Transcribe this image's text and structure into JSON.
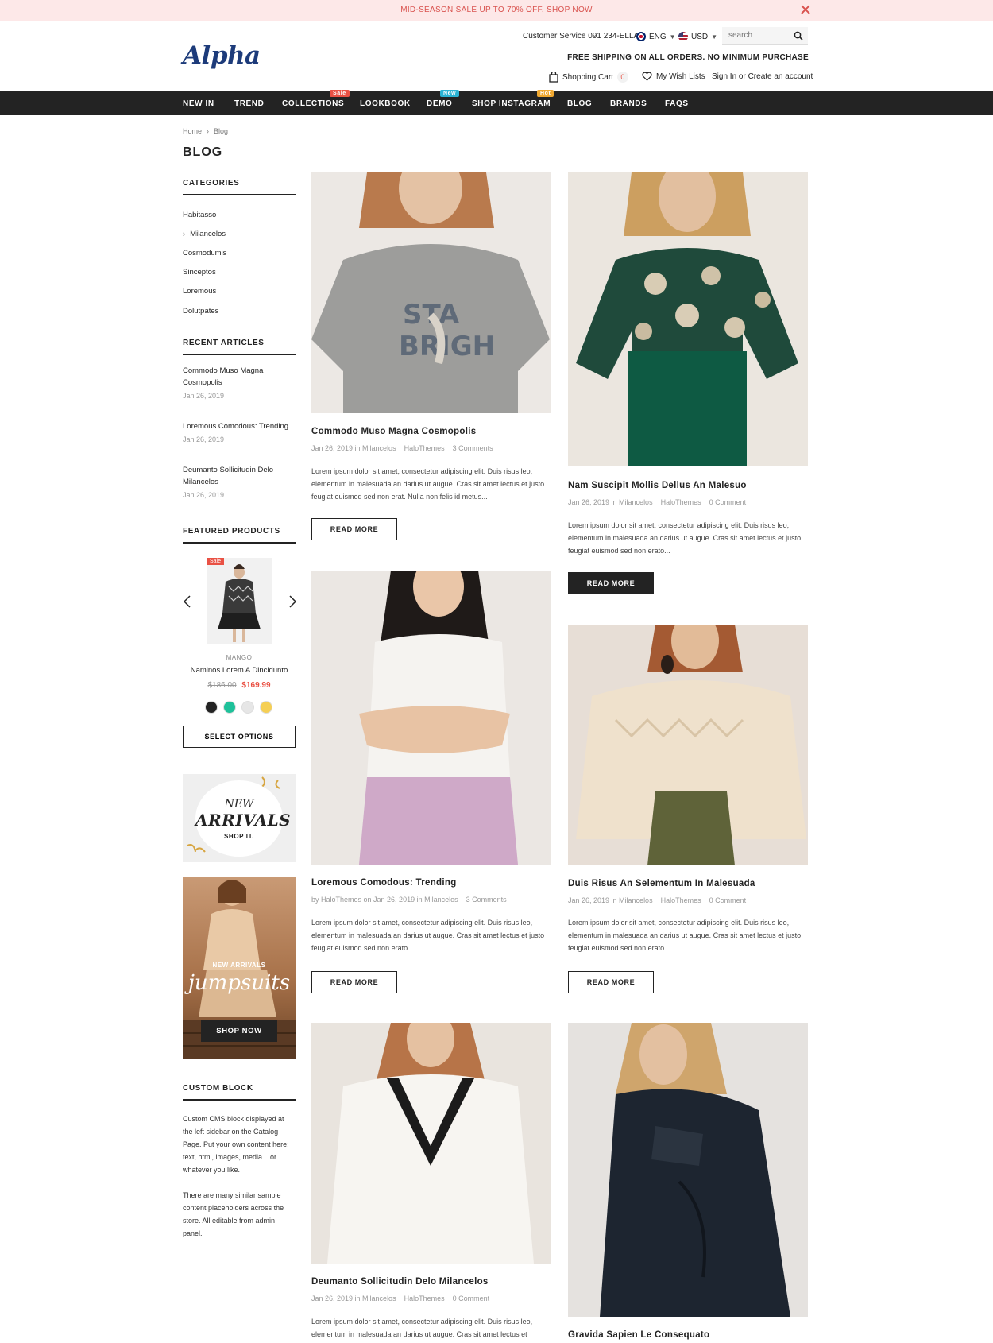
{
  "announcement": {
    "text": "MID-SEASON SALE UP TO 70% OFF. SHOP NOW"
  },
  "header": {
    "logo": "Alpha",
    "customer_service": "Customer Service 091 234-ELLA",
    "language": "ENG",
    "currency": "USD",
    "search_placeholder": "search",
    "shipping": "FREE SHIPPING ON ALL ORDERS. NO MINIMUM PURCHASE",
    "cart_label": "Shopping Cart",
    "cart_count": "0",
    "wishlist_label": "My Wish Lists",
    "account_label": "Sign In or Create an account"
  },
  "nav": [
    {
      "label": "NEW IN"
    },
    {
      "label": "TREND"
    },
    {
      "label": "COLLECTIONS",
      "badge": "Sale"
    },
    {
      "label": "LOOKBOOK"
    },
    {
      "label": "DEMO",
      "badge": "New"
    },
    {
      "label": "SHOP INSTAGRAM",
      "badge": "Hot"
    },
    {
      "label": "BLOG"
    },
    {
      "label": "BRANDS"
    },
    {
      "label": "FAQS"
    }
  ],
  "breadcrumb": {
    "home": "Home",
    "current": "Blog"
  },
  "page_title": "BLOG",
  "sidebar": {
    "categories_title": "CATEGORIES",
    "categories": [
      "Habitasso",
      "Milancelos",
      "Cosmodumis",
      "Sinceptos",
      "Loremous",
      "Dolutpates"
    ],
    "recent_title": "RECENT ARTICLES",
    "recent": [
      {
        "title": "Commodo Muso Magna Cosmopolis",
        "date": "Jan 26, 2019"
      },
      {
        "title": "Loremous Comodous: Trending",
        "date": "Jan 26, 2019"
      },
      {
        "title": "Deumanto Sollicitudin Delo Milancelos",
        "date": "Jan 26, 2019"
      }
    ],
    "featured_title": "FEATURED PRODUCTS",
    "product": {
      "badge": "Sale",
      "brand": "MANGO",
      "name": "Naminos Lorem A Dincidunto",
      "old_price": "$186.00",
      "new_price": "$169.99",
      "swatches": [
        "#232323",
        "#1ec19a",
        "#e6e6e6",
        "#f5cf55"
      ],
      "button": "SELECT OPTIONS"
    },
    "banner1": {
      "line1": "NEW",
      "line2": "ARRIVALS",
      "cta": "SHOP IT."
    },
    "banner2": {
      "sub": "NEW ARRIVALS",
      "script": "jumpsuits",
      "cta": "SHOP NOW"
    },
    "custom_title": "CUSTOM BLOCK",
    "custom_p1": "Custom CMS block displayed at the left sidebar on the Catalog Page. Put your own content here: text, html, images, media... or whatever you like.",
    "custom_p2": "There are many similar sample content placeholders across the store. All editable from admin panel."
  },
  "posts": [
    {
      "title": "Commodo Muso Magna Cosmopolis",
      "date": "Jan 26, 2019 in Milancelos",
      "author": "HaloThemes",
      "comments": "3 Comments",
      "excerpt": "Lorem ipsum dolor sit amet, consectetur adipiscing elit. Duis risus leo, elementum in malesuada an darius ut augue. Cras sit amet lectus et justo feugiat euismod sed non erat. Nulla non felis id metus...",
      "button": "READ MORE"
    },
    {
      "title": "Nam Suscipit Mollis Dellus An Malesuo",
      "date": "Jan 26, 2019 in Milancelos",
      "author": "HaloThemes",
      "comments": "0 Comment",
      "excerpt": "Lorem ipsum dolor sit amet, consectetur adipiscing elit. Duis risus leo, elementum in malesuada an darius ut augue. Cras sit amet lectus et justo feugiat euismod sed non erato...",
      "button": "READ MORE"
    },
    {
      "title": "Loremous Comodous: Trending",
      "date": "by HaloThemes on Jan 26, 2019 in Milancelos",
      "author": "",
      "comments": "3 Comments",
      "excerpt": "Lorem ipsum dolor sit amet, consectetur adipiscing elit. Duis risus leo, elementum in malesuada an darius ut augue. Cras sit amet lectus et justo feugiat euismod sed non erato...",
      "button": "READ MORE"
    },
    {
      "title": "Duis Risus An Selementum In Malesuada",
      "date": "Jan 26, 2019 in Milancelos",
      "author": "HaloThemes",
      "comments": "0 Comment",
      "excerpt": "Lorem ipsum dolor sit amet, consectetur adipiscing elit. Duis risus leo, elementum in malesuada an darius ut augue. Cras sit amet lectus et justo feugiat euismod sed non erato...",
      "button": "READ MORE"
    },
    {
      "title": "Deumanto Sollicitudin Delo Milancelos",
      "date": "Jan 26, 2019 in Milancelos",
      "author": "HaloThemes",
      "comments": "0 Comment",
      "excerpt": "Lorem ipsum dolor sit amet, consectetur adipiscing elit. Duis risus leo, elementum in malesuada an darius ut augue. Cras sit amet lectus et",
      "button": "READ MORE"
    },
    {
      "title": "Gravida Sapien Le Consequato",
      "date": "",
      "author": "",
      "comments": "",
      "excerpt": "",
      "button": ""
    }
  ],
  "colors": {
    "accent": "#e95144",
    "dark": "#232323",
    "announce_bg": "#fde8e8",
    "logo": "#1d3b7a"
  }
}
